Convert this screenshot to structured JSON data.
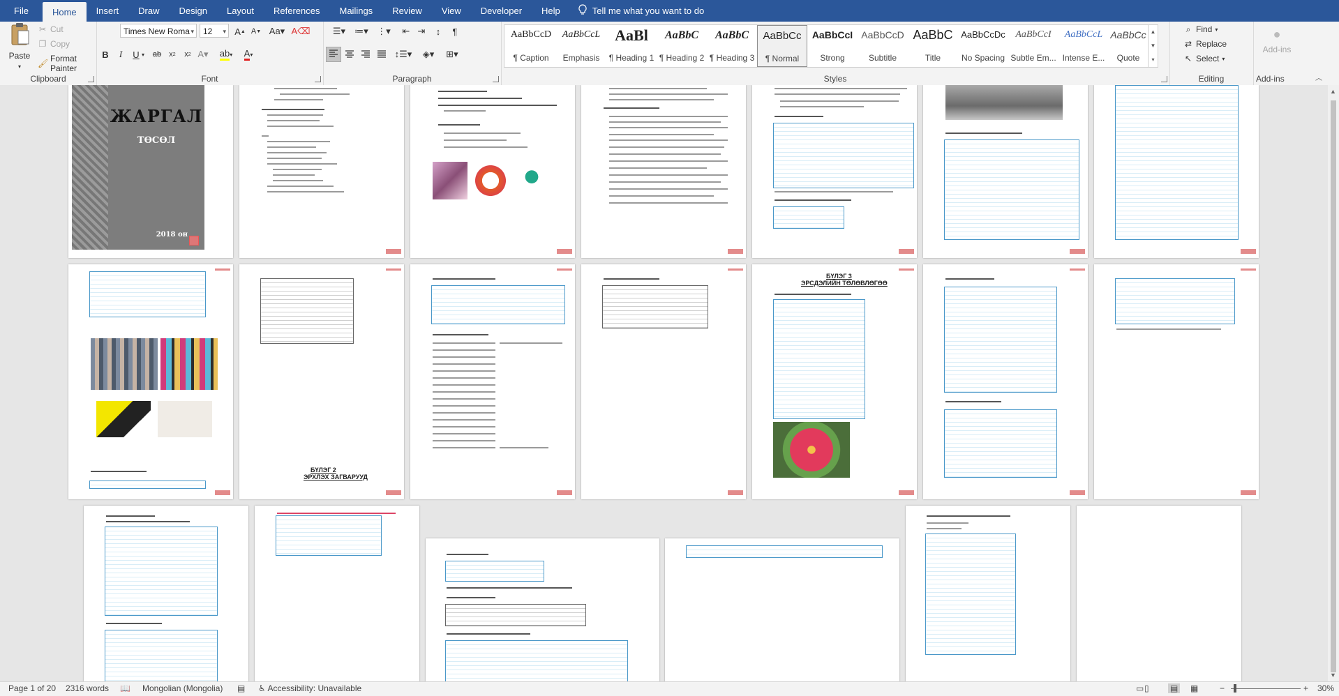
{
  "tabs": [
    {
      "label": "File"
    },
    {
      "label": "Home",
      "active": true
    },
    {
      "label": "Insert"
    },
    {
      "label": "Draw"
    },
    {
      "label": "Design"
    },
    {
      "label": "Layout"
    },
    {
      "label": "References"
    },
    {
      "label": "Mailings"
    },
    {
      "label": "Review"
    },
    {
      "label": "View"
    },
    {
      "label": "Developer"
    },
    {
      "label": "Help"
    }
  ],
  "tell_me": "Tell me what you want to do",
  "clipboard": {
    "paste": "Paste",
    "cut": "Cut",
    "copy": "Copy",
    "format_painter": "Format Painter",
    "group": "Clipboard"
  },
  "font": {
    "name": "Times New Roma",
    "size": "12",
    "group": "Font"
  },
  "paragraph": {
    "group": "Paragraph"
  },
  "styles": {
    "group": "Styles",
    "items": [
      {
        "sample": "AaBbCcD",
        "name": "¶ Caption"
      },
      {
        "sample": "AaBbCcL",
        "name": "Emphasis"
      },
      {
        "sample": "AaBl",
        "name": "¶ Heading 1"
      },
      {
        "sample": "AaBbC",
        "name": "¶ Heading 2"
      },
      {
        "sample": "AaBbC",
        "name": "¶ Heading 3"
      },
      {
        "sample": "AaBbCc",
        "name": "¶ Normal",
        "selected": true
      },
      {
        "sample": "AaBbCcI",
        "name": "Strong"
      },
      {
        "sample": "AaBbCcD",
        "name": "Subtitle"
      },
      {
        "sample": "AaBbC",
        "name": "Title"
      },
      {
        "sample": "AaBbCcDc",
        "name": "No Spacing"
      },
      {
        "sample": "AaBbCcI",
        "name": "Subtle Em..."
      },
      {
        "sample": "AaBbCcL",
        "name": "Intense E..."
      },
      {
        "sample": "AaBbCc",
        "name": "Quote"
      }
    ]
  },
  "editing": {
    "find": "Find",
    "replace": "Replace",
    "select": "Select",
    "group": "Editing"
  },
  "addins": {
    "label": "Add-ins",
    "group": "Add-ins"
  },
  "cover": {
    "title": "ЖАРГАЛ",
    "subtitle": "ТӨСӨЛ",
    "year": "2018 он"
  },
  "page_headings": {
    "p14": "БҮЛЭГ 3",
    "p14b": "ЭРСДЭЛИЙН ТӨЛӨВЛӨГӨӨ",
    "p12": "БҮЛЭГ 2",
    "p12b": "ЭРХЛЭХ ЗАГВАРУУД"
  },
  "status": {
    "page": "Page 1 of 20",
    "words": "2316 words",
    "language": "Mongolian (Mongolia)",
    "accessibility": "Accessibility: Unavailable",
    "zoom": "30%"
  }
}
